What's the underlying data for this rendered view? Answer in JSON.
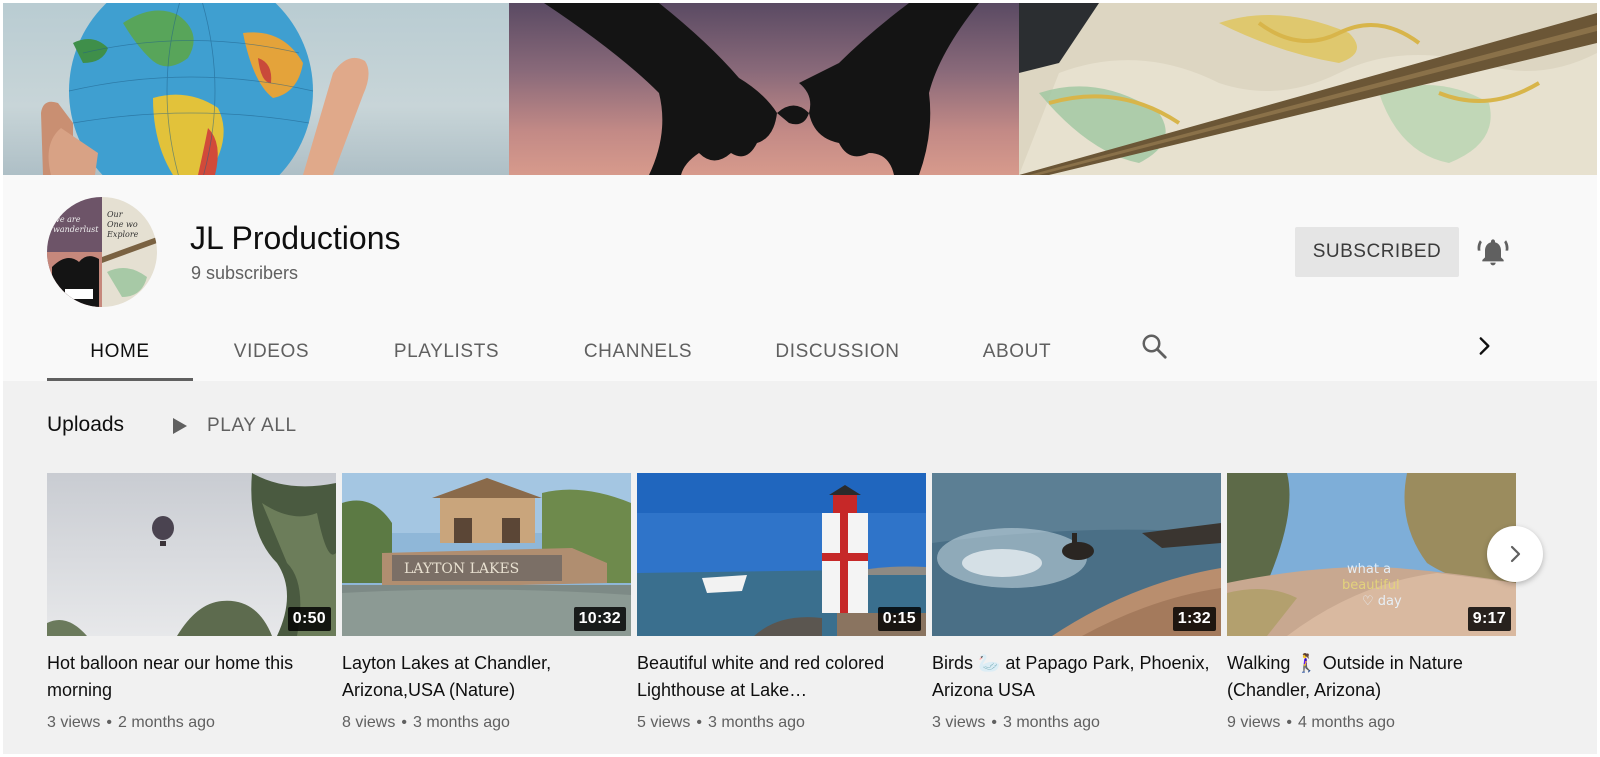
{
  "channel": {
    "name": "JL Productions",
    "subscribers": "9 subscribers",
    "subscribe_label": "SUBSCRIBED"
  },
  "tabs": [
    {
      "label": "HOME",
      "active": true
    },
    {
      "label": "VIDEOS",
      "active": false
    },
    {
      "label": "PLAYLISTS",
      "active": false
    },
    {
      "label": "CHANNELS",
      "active": false
    },
    {
      "label": "DISCUSSION",
      "active": false
    },
    {
      "label": "ABOUT",
      "active": false
    }
  ],
  "icons": {
    "bell": "bell-icon",
    "search": "search-icon",
    "tabs_next": "chevron-right-icon",
    "play": "play-icon",
    "shelf_next": "chevron-right-icon"
  },
  "uploads": {
    "title": "Uploads",
    "play_all_label": "PLAY ALL",
    "videos": [
      {
        "title": "Hot balloon near our home this morning",
        "duration": "0:50",
        "views": "3 views",
        "age": "2 months ago"
      },
      {
        "title": "Layton Lakes at Chandler, Arizona,USA (Nature)",
        "duration": "10:32",
        "views": "8 views",
        "age": "3 months ago"
      },
      {
        "title": "Beautiful white and red colored Lighthouse at Lake…",
        "duration": "0:15",
        "views": "5 views",
        "age": "3 months ago"
      },
      {
        "title": "Birds 🦢 at Papago Park, Phoenix, Arizona USA",
        "duration": "1:32",
        "views": "3 views",
        "age": "3 months ago"
      },
      {
        "title": "Walking 🚶‍♀️ Outside in Nature (Chandler, Arizona)",
        "duration": "9:17",
        "views": "9 views",
        "age": "4 months ago"
      }
    ]
  },
  "colors": {
    "page_bg": "#f9f9f9",
    "shelf_bg": "#f1f1f1",
    "subscribed_bg": "#e5e5e5",
    "secondary_text": "#606060"
  }
}
